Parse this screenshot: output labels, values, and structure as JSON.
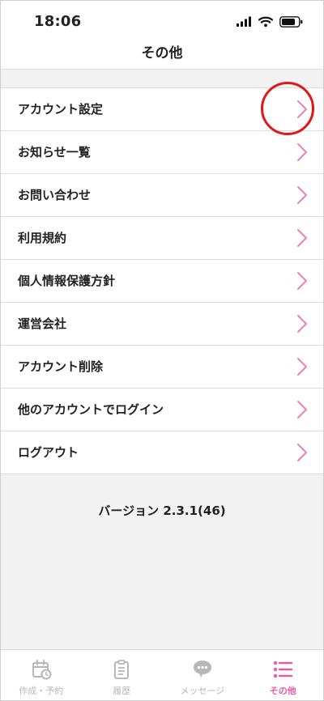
{
  "status_bar": {
    "time": "18:06"
  },
  "nav": {
    "title": "その他"
  },
  "menu": {
    "items": [
      {
        "label": "アカウント設定"
      },
      {
        "label": "お知らせ一覧"
      },
      {
        "label": "お問い合わせ"
      },
      {
        "label": "利用規約"
      },
      {
        "label": "個人情報保護方針"
      },
      {
        "label": "運営会社"
      },
      {
        "label": "アカウント削除"
      },
      {
        "label": "他のアカウントでログイン"
      },
      {
        "label": "ログアウト"
      }
    ]
  },
  "version_text": "バージョン 2.3.1(46)",
  "tabs": [
    {
      "label": "作成・予約",
      "icon": "calendar-clock-icon",
      "active": false
    },
    {
      "label": "履歴",
      "icon": "clipboard-icon",
      "active": false
    },
    {
      "label": "メッセージ",
      "icon": "chat-bubble-icon",
      "active": false
    },
    {
      "label": "その他",
      "icon": "list-icon",
      "active": true
    }
  ],
  "colors": {
    "accent": "#ea5aa4",
    "chevron": "#ee7fbf",
    "highlight_circle": "#e01818",
    "tab_inactive": "#b7b7b7"
  }
}
